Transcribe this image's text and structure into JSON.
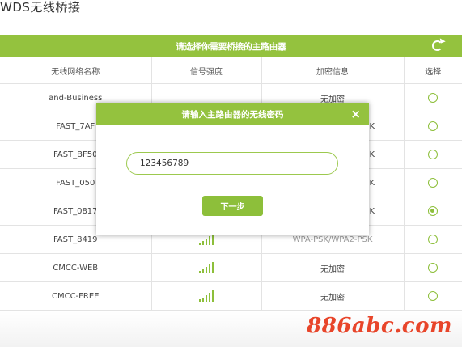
{
  "page": {
    "title": "WDS无线桥接"
  },
  "panel": {
    "header": "请选择你需要桥接的主路由器",
    "refresh_icon": "refresh-icon",
    "columns": [
      "无线网络名称",
      "信号强度",
      "加密信息",
      "选择"
    ],
    "rows": [
      {
        "ssid": "and-Business",
        "encryption": "无加密",
        "selected": false
      },
      {
        "ssid": "FAST_7AF",
        "encryption": "K",
        "selected": false
      },
      {
        "ssid": "FAST_BF50",
        "encryption": "K",
        "selected": false
      },
      {
        "ssid": "FAST_050",
        "encryption": "K",
        "selected": false
      },
      {
        "ssid": "FAST_0817",
        "encryption": "K",
        "selected": true
      },
      {
        "ssid": "FAST_8419",
        "encryption": "WPA-PSK/WPA2-PSK",
        "selected": false
      },
      {
        "ssid": "CMCC-WEB",
        "encryption": "无加密",
        "selected": false
      },
      {
        "ssid": "CMCC-FREE",
        "encryption": "无加密",
        "selected": false
      }
    ]
  },
  "modal": {
    "title": "请输入主路由器的无线密码",
    "close_glyph": "×",
    "password_value": "123456789",
    "next_label": "下一步"
  },
  "watermark": "886abc.com",
  "colors": {
    "accent": "#94c23e",
    "watermark": "#e8452a"
  }
}
